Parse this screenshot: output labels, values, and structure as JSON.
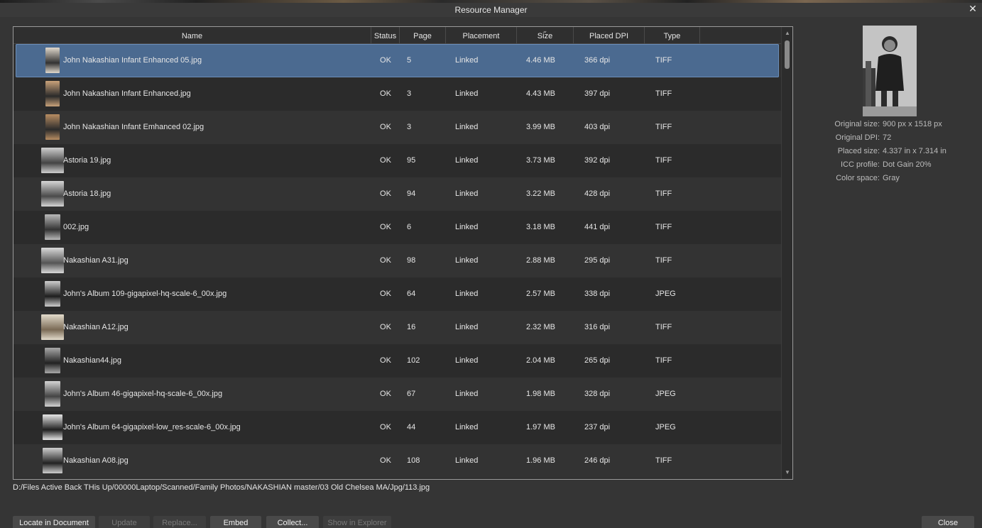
{
  "window": {
    "title": "Resource Manager"
  },
  "table": {
    "columns": {
      "name": "Name",
      "status": "Status",
      "page": "Page",
      "placement": "Placement",
      "size": "Size",
      "placed_dpi": "Placed DPI",
      "type": "Type"
    },
    "sorted_by": "Size",
    "rows": [
      {
        "name": "John Nakashian Infant Enhanced 05.jpg",
        "status": "OK",
        "page": "5",
        "placement": "Linked",
        "size": "4.46 MB",
        "dpi": "366 dpi",
        "type": "TIFF",
        "selected": true
      },
      {
        "name": "John Nakashian Infant Enhanced.jpg",
        "status": "OK",
        "page": "3",
        "placement": "Linked",
        "size": "4.43 MB",
        "dpi": "397 dpi",
        "type": "TIFF"
      },
      {
        "name": "John Nakashian Infant Emhanced 02.jpg",
        "status": "OK",
        "page": "3",
        "placement": "Linked",
        "size": "3.99 MB",
        "dpi": "403 dpi",
        "type": "TIFF"
      },
      {
        "name": "Astoria 19.jpg",
        "status": "OK",
        "page": "95",
        "placement": "Linked",
        "size": "3.73 MB",
        "dpi": "392 dpi",
        "type": "TIFF"
      },
      {
        "name": "Astoria 18.jpg",
        "status": "OK",
        "page": "94",
        "placement": "Linked",
        "size": "3.22 MB",
        "dpi": "428 dpi",
        "type": "TIFF"
      },
      {
        "name": "002.jpg",
        "status": "OK",
        "page": "6",
        "placement": "Linked",
        "size": "3.18 MB",
        "dpi": "441 dpi",
        "type": "TIFF"
      },
      {
        "name": "Nakashian A31.jpg",
        "status": "OK",
        "page": "98",
        "placement": "Linked",
        "size": "2.88 MB",
        "dpi": "295 dpi",
        "type": "TIFF"
      },
      {
        "name": "John's Album 109-gigapixel-hq-scale-6_00x.jpg",
        "status": "OK",
        "page": "64",
        "placement": "Linked",
        "size": "2.57 MB",
        "dpi": "338 dpi",
        "type": "JPEG"
      },
      {
        "name": "Nakashian A12.jpg",
        "status": "OK",
        "page": "16",
        "placement": "Linked",
        "size": "2.32 MB",
        "dpi": "316 dpi",
        "type": "TIFF"
      },
      {
        "name": "Nakashian44.jpg",
        "status": "OK",
        "page": "102",
        "placement": "Linked",
        "size": "2.04 MB",
        "dpi": "265 dpi",
        "type": "TIFF"
      },
      {
        "name": "John's Album 46-gigapixel-hq-scale-6_00x.jpg",
        "status": "OK",
        "page": "67",
        "placement": "Linked",
        "size": "1.98 MB",
        "dpi": "328 dpi",
        "type": "JPEG"
      },
      {
        "name": "John's Album 64-gigapixel-low_res-scale-6_00x.jpg",
        "status": "OK",
        "page": "44",
        "placement": "Linked",
        "size": "1.97 MB",
        "dpi": "237 dpi",
        "type": "JPEG"
      },
      {
        "name": "Nakashian A08.jpg",
        "status": "OK",
        "page": "108",
        "placement": "Linked",
        "size": "1.96 MB",
        "dpi": "246 dpi",
        "type": "TIFF"
      }
    ]
  },
  "info_panel": {
    "original_size_label": "Original size:",
    "original_size_value": "900 px x 1518 px",
    "original_dpi_label": "Original DPI:",
    "original_dpi_value": "72",
    "placed_size_label": "Placed size:",
    "placed_size_value": "4.337 in x 7.314 in",
    "icc_profile_label": "ICC profile:",
    "icc_profile_value": "Dot Gain 20%",
    "color_space_label": "Color space:",
    "color_space_value": "Gray"
  },
  "path": "D:/Files Active Back THis Up/00000Laptop/Scanned/Family Photos/NAKASHIAN master/03 Old Chelsea MA/Jpg/113.jpg",
  "buttons": {
    "locate": "Locate in Document",
    "update": "Update",
    "replace": "Replace...",
    "embed": "Embed",
    "collect": "Collect...",
    "show_in_explorer": "Show in Explorer",
    "close": "Close"
  },
  "colors": {
    "selection": "#4b6a90",
    "background": "#353535"
  }
}
